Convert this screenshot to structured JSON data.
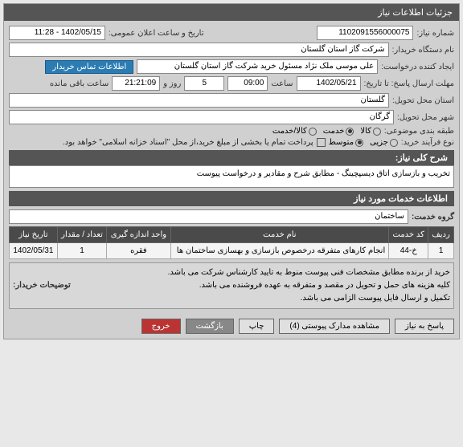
{
  "header": {
    "title": "جزئیات اطلاعات نیاز"
  },
  "fields": {
    "need_number_label": "شماره نیاز:",
    "need_number": "1102091556000075",
    "announce_date_label": "تاریخ و ساعت اعلان عمومی:",
    "announce_date": "1402/05/15 - 11:28",
    "buyer_org_label": "نام دستگاه خریدار:",
    "buyer_org": "شرکت گاز استان گلستان",
    "requester_label": "ایجاد کننده درخواست:",
    "requester": "علی موسی ملک نژاد مسئول خرید شرکت گاز استان گلستان",
    "contact_btn": "اطلاعات تماس خریدار",
    "deadline_label": "مهلت ارسال پاسخ: تا تاریخ:",
    "deadline_date": "1402/05/21",
    "time_label": "ساعت",
    "deadline_time": "09:00",
    "days_and": "روز و",
    "days_remaining": "5",
    "countdown": "21:21:09",
    "remaining_label": "ساعت باقی مانده",
    "province_label": "استان محل تحویل:",
    "province": "گلستان",
    "city_label": "شهر محل تحویل:",
    "city": "گرگان",
    "category_label": "طبقه بندی موضوعی:",
    "cat_goods": "کالا",
    "cat_service": "خدمت",
    "cat_goods_service": "کالا/خدمت",
    "process_type_label": "نوع فرآیند خرید:",
    "proc_small": "جزیی",
    "proc_medium": "متوسط",
    "payment_note": "پرداخت تمام یا بخشی از مبلغ خرید،از محل \"اسناد خزانه اسلامی\" خواهد بود."
  },
  "general_desc": {
    "title": "شرح کلی نیاز:",
    "text": "تخریب و بازسازی اتاق دیسپچینگ - مطابق شرح و مقادیر و درخواست پیوست"
  },
  "services_info": {
    "title": "اطلاعات خدمات مورد نیاز",
    "group_label": "گروه خدمت:",
    "group_value": "ساختمان"
  },
  "table": {
    "headers": {
      "row": "ردیف",
      "code": "کد خدمت",
      "name": "نام خدمت",
      "unit": "واحد اندازه گیری",
      "qty": "تعداد / مقدار",
      "date": "تاریخ نیاز"
    },
    "rows": [
      {
        "row": "1",
        "code": "خ-44",
        "name": "انجام کارهای متفرقه درخصوص بازسازی و بهسازی ساختمان ها",
        "unit": "فقره",
        "qty": "1",
        "date": "1402/05/31"
      }
    ]
  },
  "buyer_notes": {
    "label": "توضیحات خریدار:",
    "line1": "خرید از برنده مطابق مشخصات فنی پیوست منوط به تایید کارشناس شرکت می باشد.",
    "line2": "کلیه هزینه های حمل و تحویل در مقصد  و متفرقه به عهده فروشنده می باشد.",
    "line3": "تکمیل و ارسال فایل پیوست الزامی می باشد."
  },
  "footer": {
    "reply": "پاسخ به نیاز",
    "attachments": "مشاهده مدارک پیوستی (4)",
    "print": "چاپ",
    "back": "بازگشت",
    "exit": "خروج"
  }
}
